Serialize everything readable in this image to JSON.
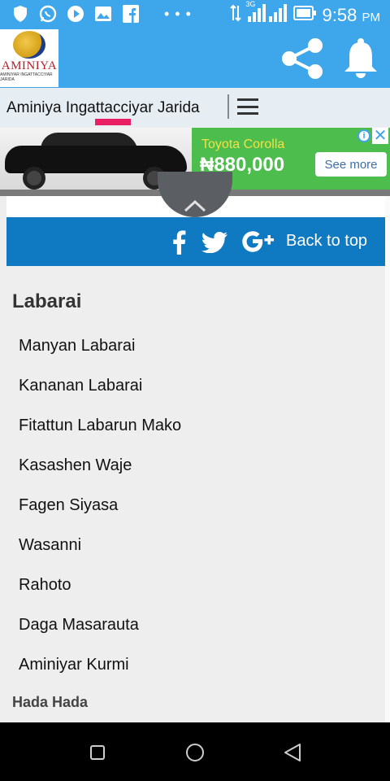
{
  "status_bar": {
    "time": "9:58",
    "ampm": "PM",
    "network": "3G",
    "icons": [
      "shield-icon",
      "whatsapp-icon",
      "play-icon",
      "gallery-icon",
      "facebook-icon",
      "more-dots-icon",
      "data-transfer-icon",
      "signal-icon",
      "battery-icon"
    ]
  },
  "header": {
    "logo_name": "AMINIYA",
    "logo_tagline": "AMINIYAR INGATTACCIYAR JARIDA",
    "site_title": "Aminiya Ingattacciyar Jarida"
  },
  "colors": {
    "primary": "#3ea6ea",
    "footer_bar": "#0f7ac1",
    "accent_indicator": "#e91e63",
    "ad_green": "#4dbd4d"
  },
  "ad": {
    "headline": "Toyota Corolla",
    "price": "₦880,000",
    "cta": "See more"
  },
  "footer": {
    "back_to_top": "Back to top"
  },
  "menu": {
    "heading": "Labarai",
    "items": [
      "Manyan Labarai",
      "Kananan Labarai",
      "Fitattun Labarun Mako",
      "Kasashen Waje",
      "Fagen Siyasa",
      "Wasanni",
      "Rahoto",
      "Daga Masarauta",
      "Aminiyar Kurmi"
    ],
    "next_heading": "Hada Hada"
  }
}
